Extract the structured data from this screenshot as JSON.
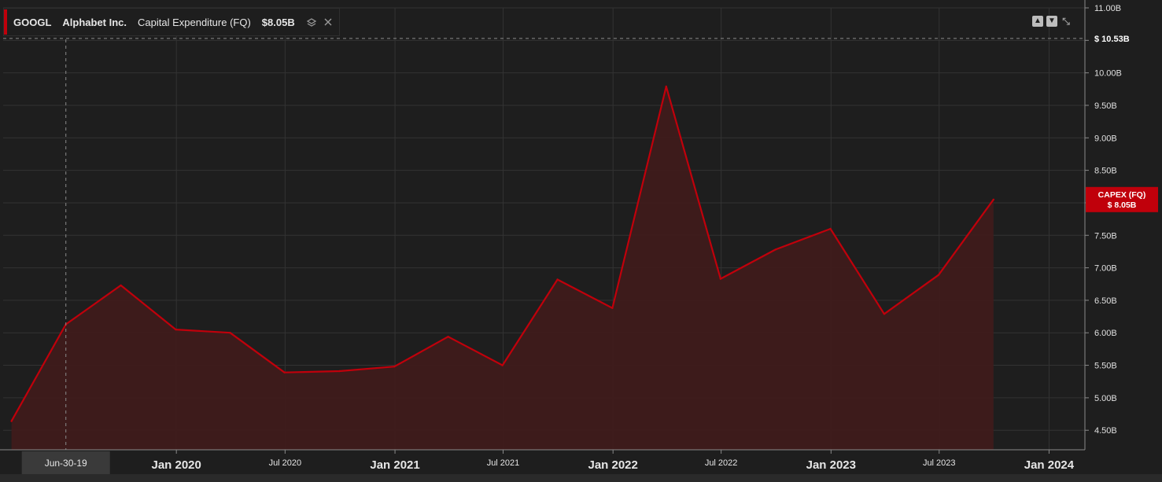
{
  "legend": {
    "ticker": "GOOGL",
    "company": "Alphabet Inc.",
    "metric": "Capital Expenditure (FQ)",
    "value": "$8.05B",
    "accent": "#c0000b",
    "stack_icon": "stack-icon",
    "close_icon": "close-icon"
  },
  "controls": {
    "icons": [
      "move-up-icon",
      "move-down-icon",
      "collapse-icon"
    ]
  },
  "crosshair": {
    "x_label": "Jun-30-19",
    "y_label": "$ 10.53B"
  },
  "badge": {
    "line1": "CAPEX (FQ)",
    "line2": "$ 8.05B",
    "color": "#c0000b"
  },
  "colors": {
    "background": "#1e1e1e",
    "grid": "#333333",
    "line": "#c0000b",
    "fill": "#3f1b1b"
  },
  "chart_data": {
    "type": "area",
    "x": [
      "2019-03-31",
      "2019-06-30",
      "2019-09-30",
      "2019-12-31",
      "2020-03-31",
      "2020-06-30",
      "2020-09-30",
      "2020-12-31",
      "2021-03-31",
      "2021-06-30",
      "2021-09-30",
      "2021-12-31",
      "2022-03-31",
      "2022-06-30",
      "2022-09-30",
      "2022-12-31",
      "2023-03-31",
      "2023-06-30",
      "2023-09-30"
    ],
    "series": [
      {
        "name": "CAPEX (FQ)",
        "values": [
          4.64,
          6.13,
          6.73,
          6.05,
          6.0,
          5.39,
          5.41,
          5.48,
          5.94,
          5.5,
          6.82,
          6.38,
          9.79,
          6.83,
          7.28,
          7.6,
          6.29,
          6.89,
          8.05
        ]
      }
    ],
    "ylim": [
      4.2,
      11.0
    ],
    "y_ticks": [
      4.5,
      5.0,
      5.5,
      6.0,
      6.5,
      7.0,
      7.5,
      8.0,
      8.5,
      9.0,
      9.5,
      10.0,
      10.5,
      11.0
    ],
    "y_tick_labels": [
      "4.50B",
      "5.00B",
      "5.50B",
      "6.00B",
      "6.50B",
      "7.00B",
      "7.50B",
      "",
      "8.50B",
      "9.00B",
      "9.50B",
      "10.00B",
      "",
      "11.00B"
    ],
    "x_ticks": [
      {
        "date": "2020-01-01",
        "label": "Jan 2020",
        "major": true
      },
      {
        "date": "2020-07-01",
        "label": "Jul 2020",
        "major": false
      },
      {
        "date": "2021-01-01",
        "label": "Jan 2021",
        "major": true
      },
      {
        "date": "2021-07-01",
        "label": "Jul 2021",
        "major": false
      },
      {
        "date": "2022-01-01",
        "label": "Jan 2022",
        "major": true
      },
      {
        "date": "2022-07-01",
        "label": "Jul 2022",
        "major": false
      },
      {
        "date": "2023-01-01",
        "label": "Jan 2023",
        "major": true
      },
      {
        "date": "2023-07-01",
        "label": "Jul 2023",
        "major": false
      },
      {
        "date": "2024-01-01",
        "label": "Jan 2024",
        "major": true
      }
    ],
    "xlim": [
      "2019-03-17",
      "2024-03-01"
    ],
    "crosshair_date": "2019-06-30",
    "crosshair_value": 10.53,
    "grid": true
  }
}
